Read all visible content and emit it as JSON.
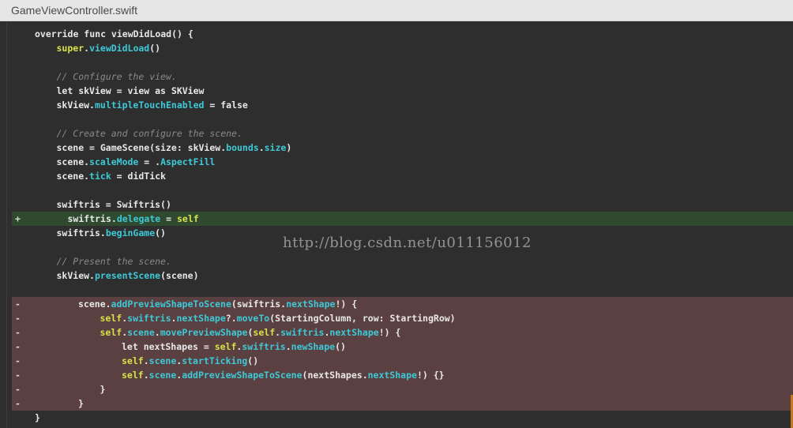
{
  "tab": {
    "title": "GameViewController.swift"
  },
  "watermark": "http://blog.csdn.net/u011156012",
  "colors": {
    "added_bg": "#2f4a2f",
    "removed_bg": "#5a4040",
    "property": "#3ec9d8",
    "super": "#d7e24a",
    "comment": "#8a8a8a"
  },
  "lines": [
    {
      "marker": "",
      "indent": 0,
      "tokens": [
        [
          "kw",
          "override func viewDidLoad() {"
        ]
      ]
    },
    {
      "marker": "",
      "indent": 1,
      "tokens": [
        [
          "super",
          "super"
        ],
        [
          "id",
          "."
        ],
        [
          "prop",
          "viewDidLoad"
        ],
        [
          "id",
          "()"
        ]
      ]
    },
    {
      "marker": "",
      "indent": 1,
      "tokens": []
    },
    {
      "marker": "",
      "indent": 1,
      "tokens": [
        [
          "comment",
          "// Configure the view."
        ]
      ]
    },
    {
      "marker": "",
      "indent": 1,
      "tokens": [
        [
          "kw",
          "let skView = view as SKView"
        ]
      ]
    },
    {
      "marker": "",
      "indent": 1,
      "tokens": [
        [
          "id",
          "skView."
        ],
        [
          "prop",
          "multipleTouchEnabled"
        ],
        [
          "id",
          " = false"
        ]
      ]
    },
    {
      "marker": "",
      "indent": 1,
      "tokens": []
    },
    {
      "marker": "",
      "indent": 1,
      "tokens": [
        [
          "comment",
          "// Create and configure the scene."
        ]
      ]
    },
    {
      "marker": "",
      "indent": 1,
      "tokens": [
        [
          "id",
          "scene = GameScene(size: skView."
        ],
        [
          "prop",
          "bounds"
        ],
        [
          "id",
          "."
        ],
        [
          "prop",
          "size"
        ],
        [
          "id",
          ")"
        ]
      ]
    },
    {
      "marker": "",
      "indent": 1,
      "tokens": [
        [
          "id",
          "scene."
        ],
        [
          "prop",
          "scaleMode"
        ],
        [
          "id",
          " = ."
        ],
        [
          "prop",
          "AspectFill"
        ]
      ]
    },
    {
      "marker": "",
      "indent": 1,
      "tokens": [
        [
          "id",
          "scene."
        ],
        [
          "prop",
          "tick"
        ],
        [
          "id",
          " = didTick"
        ]
      ]
    },
    {
      "marker": "",
      "indent": 1,
      "tokens": []
    },
    {
      "marker": "",
      "indent": 1,
      "tokens": [
        [
          "id",
          "swiftris = Swiftris()"
        ]
      ]
    },
    {
      "marker": "+",
      "indent": 1,
      "extra": 14,
      "tokens": [
        [
          "id",
          "swiftris."
        ],
        [
          "prop",
          "delegate"
        ],
        [
          "id",
          " = "
        ],
        [
          "super",
          "self"
        ]
      ]
    },
    {
      "marker": "",
      "indent": 1,
      "tokens": [
        [
          "id",
          "swiftris."
        ],
        [
          "prop",
          "beginGame"
        ],
        [
          "id",
          "()"
        ]
      ]
    },
    {
      "marker": "",
      "indent": 1,
      "tokens": []
    },
    {
      "marker": "",
      "indent": 1,
      "tokens": [
        [
          "comment",
          "// Present the scene."
        ]
      ]
    },
    {
      "marker": "",
      "indent": 1,
      "tokens": [
        [
          "id",
          "skView."
        ],
        [
          "prop",
          "presentScene"
        ],
        [
          "id",
          "(scene)"
        ]
      ]
    },
    {
      "marker": "",
      "indent": 1,
      "tokens": []
    },
    {
      "marker": "-",
      "indent": 2,
      "tokens": [
        [
          "id",
          "scene."
        ],
        [
          "prop",
          "addPreviewShapeToScene"
        ],
        [
          "id",
          "(swiftris."
        ],
        [
          "prop",
          "nextShape"
        ],
        [
          "id",
          "!) {"
        ]
      ]
    },
    {
      "marker": "-",
      "indent": 3,
      "tokens": [
        [
          "super",
          "self"
        ],
        [
          "id",
          "."
        ],
        [
          "prop",
          "swiftris"
        ],
        [
          "id",
          "."
        ],
        [
          "prop",
          "nextShape"
        ],
        [
          "id",
          "?."
        ],
        [
          "prop",
          "moveTo"
        ],
        [
          "id",
          "(StartingColumn, row: StartingRow)"
        ]
      ]
    },
    {
      "marker": "-",
      "indent": 3,
      "tokens": [
        [
          "super",
          "self"
        ],
        [
          "id",
          "."
        ],
        [
          "prop",
          "scene"
        ],
        [
          "id",
          "."
        ],
        [
          "prop",
          "movePreviewShape"
        ],
        [
          "id",
          "("
        ],
        [
          "super",
          "self"
        ],
        [
          "id",
          "."
        ],
        [
          "prop",
          "swiftris"
        ],
        [
          "id",
          "."
        ],
        [
          "prop",
          "nextShape"
        ],
        [
          "id",
          "!) {"
        ]
      ]
    },
    {
      "marker": "-",
      "indent": 4,
      "tokens": [
        [
          "id",
          "let nextShapes = "
        ],
        [
          "super",
          "self"
        ],
        [
          "id",
          "."
        ],
        [
          "prop",
          "swiftris"
        ],
        [
          "id",
          "."
        ],
        [
          "prop",
          "newShape"
        ],
        [
          "id",
          "()"
        ]
      ]
    },
    {
      "marker": "-",
      "indent": 4,
      "tokens": [
        [
          "super",
          "self"
        ],
        [
          "id",
          "."
        ],
        [
          "prop",
          "scene"
        ],
        [
          "id",
          "."
        ],
        [
          "prop",
          "startTicking"
        ],
        [
          "id",
          "()"
        ]
      ]
    },
    {
      "marker": "-",
      "indent": 4,
      "tokens": [
        [
          "super",
          "self"
        ],
        [
          "id",
          "."
        ],
        [
          "prop",
          "scene"
        ],
        [
          "id",
          "."
        ],
        [
          "prop",
          "addPreviewShapeToScene"
        ],
        [
          "id",
          "(nextShapes."
        ],
        [
          "prop",
          "nextShape"
        ],
        [
          "id",
          "!) {}"
        ]
      ]
    },
    {
      "marker": "-",
      "indent": 3,
      "tokens": [
        [
          "id",
          "}"
        ]
      ]
    },
    {
      "marker": "-",
      "indent": 2,
      "tokens": [
        [
          "id",
          "}"
        ]
      ]
    },
    {
      "marker": "",
      "indent": 0,
      "tokens": [
        [
          "id",
          "}"
        ]
      ]
    }
  ]
}
